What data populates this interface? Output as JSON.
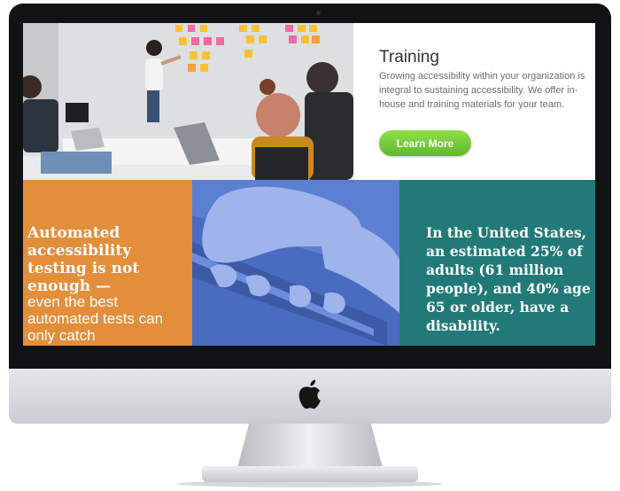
{
  "training": {
    "title": "Training",
    "body": "Growing accessibility within your organization is integral to sustaining accessibility. We offer in-house and training materials for your team.",
    "button_label": "Learn More"
  },
  "automated": {
    "bold_text": "Automated accessibility testing is not enough —",
    "rest_text": "even the best automated tests can only catch"
  },
  "stats": {
    "text": "In the United States, an estimated 25% of adults (61 million people), and 40% age 65 or older, have a disability."
  },
  "colors": {
    "orange": "#e28e3b",
    "teal": "#217a78",
    "blue_overlay": "#5b7fd2",
    "button_green": "#6cc23a"
  },
  "icons": [
    "apple-logo-icon"
  ]
}
